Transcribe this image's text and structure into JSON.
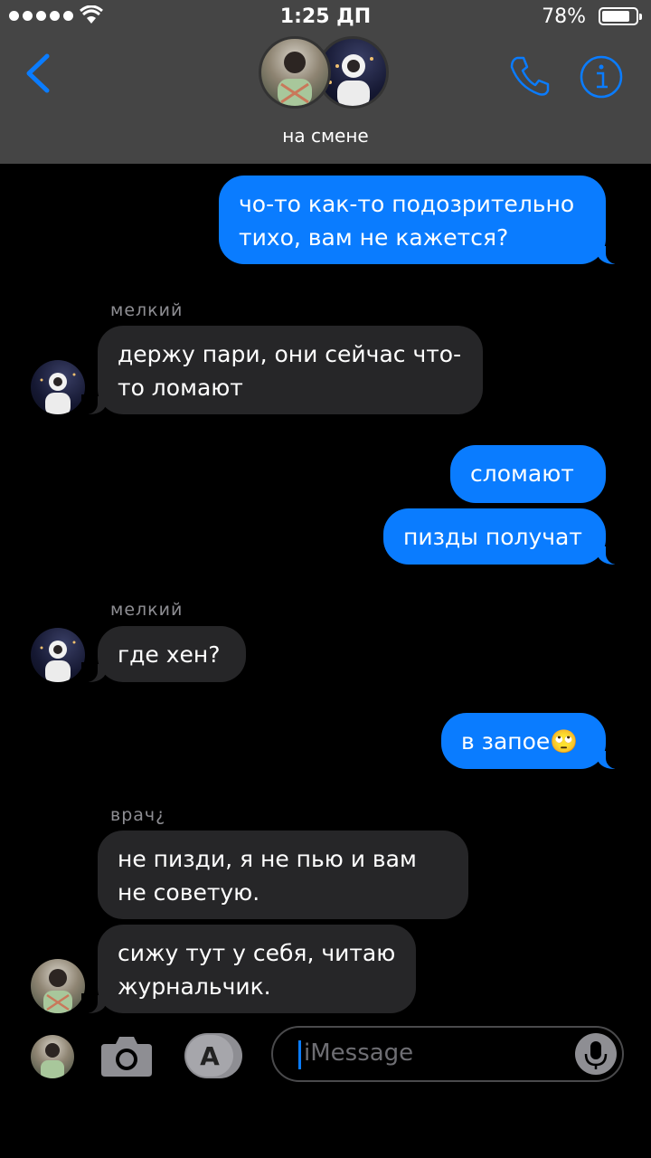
{
  "status": {
    "time": "1:25 ДП",
    "battery": "78%"
  },
  "header": {
    "group_name": "на смене"
  },
  "messages": [
    {
      "text": "чо-то как-то подозрительно тихо, вам не кажется?"
    },
    {
      "sender": "мелкий",
      "text": "держу пари, они сейчас что-то ломают"
    },
    {
      "text": "сломают"
    },
    {
      "text": "пизды получат"
    },
    {
      "sender": "мелкий",
      "text": "где хен?"
    },
    {
      "text": "в запое🙄"
    },
    {
      "sender": "врач¿",
      "text": "не пизди, я не пью и вам не советую."
    },
    {
      "text": "сижу тут у себя, читаю журнальчик."
    }
  ],
  "input": {
    "placeholder": "iMessage"
  },
  "colors": {
    "outgoing": "#0a7cff",
    "incoming": "#262628",
    "header": "#454545"
  }
}
